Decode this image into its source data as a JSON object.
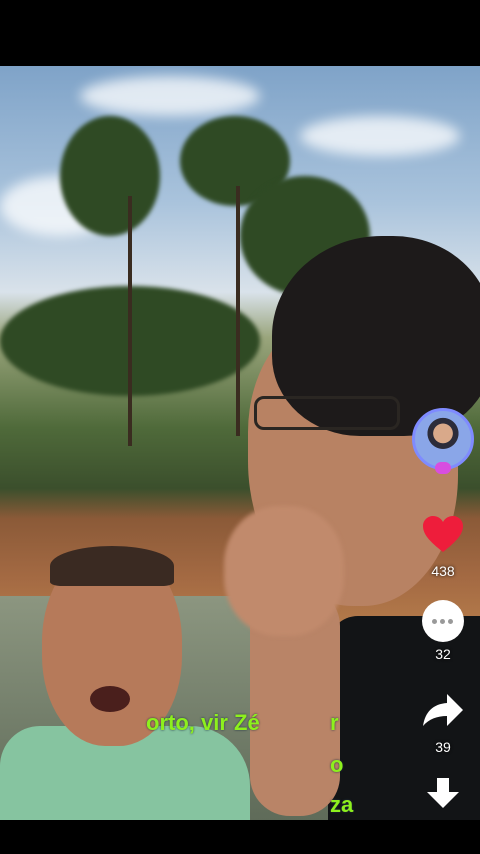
{
  "captions": {
    "line1": "orto, vir Zé",
    "line1_tail": "r",
    "line2": "o",
    "line3": "za"
  },
  "actions": {
    "likes": "438",
    "comments": "32",
    "shares": "39"
  },
  "colors": {
    "like": "#ee1d3b",
    "caption": "#8df01d",
    "avatar_ring": "#7f8bff"
  },
  "icons": {
    "like": "heart-icon",
    "comment": "comment-icon",
    "share": "share-icon",
    "download": "download-icon"
  }
}
